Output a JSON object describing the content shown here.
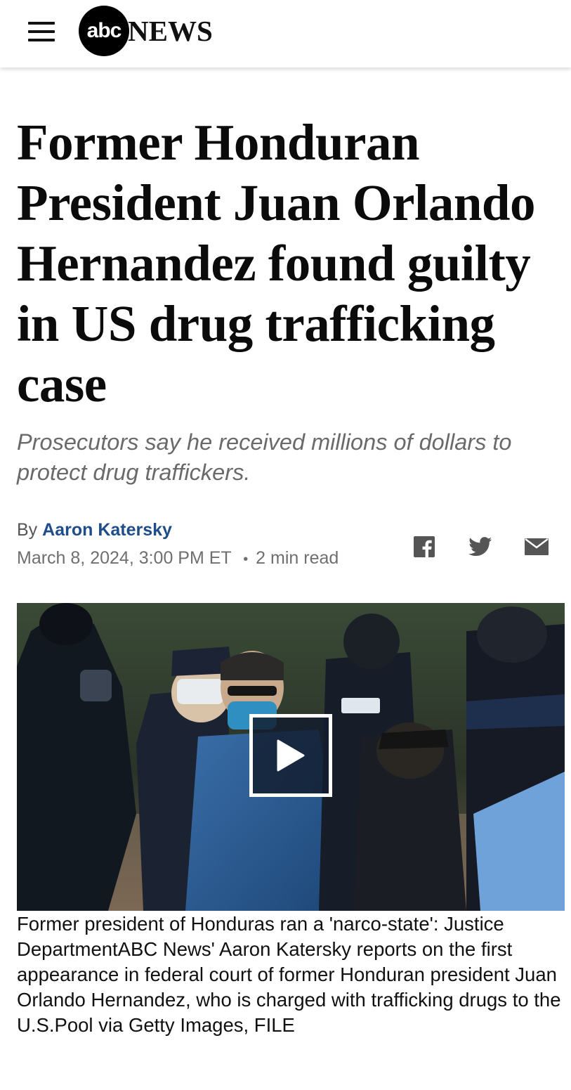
{
  "header": {
    "menu_icon": "hamburger-menu-icon",
    "logo_mark": "abc",
    "logo_text": "NEWS"
  },
  "article": {
    "headline": "Former Honduran President Juan Orlando Hernandez found guilty in US drug trafficking case",
    "subheadline": "Prosecutors say he received millions of dollars to protect drug traffickers.",
    "byline_prefix": "By",
    "author": "Aaron Katersky",
    "date": "March 8, 2024, 3:00 PM ET",
    "separator": "•",
    "read_time": "2 min read"
  },
  "share": {
    "icons": [
      "facebook-icon",
      "twitter-icon",
      "email-icon"
    ]
  },
  "media": {
    "play_icon": "play-icon",
    "caption": "Former president of Honduras ran a 'narco-state': Justice DepartmentABC News' Aaron Katersky reports on the first appearance in federal court of former Honduran president Juan Orlando Hernandez, who is charged with trafficking drugs to the U.S.Pool via Getty Images, FILE"
  },
  "colors": {
    "author_link": "#1f4d89",
    "subhead": "#6a6a6a",
    "meta": "#6f6f6f"
  }
}
